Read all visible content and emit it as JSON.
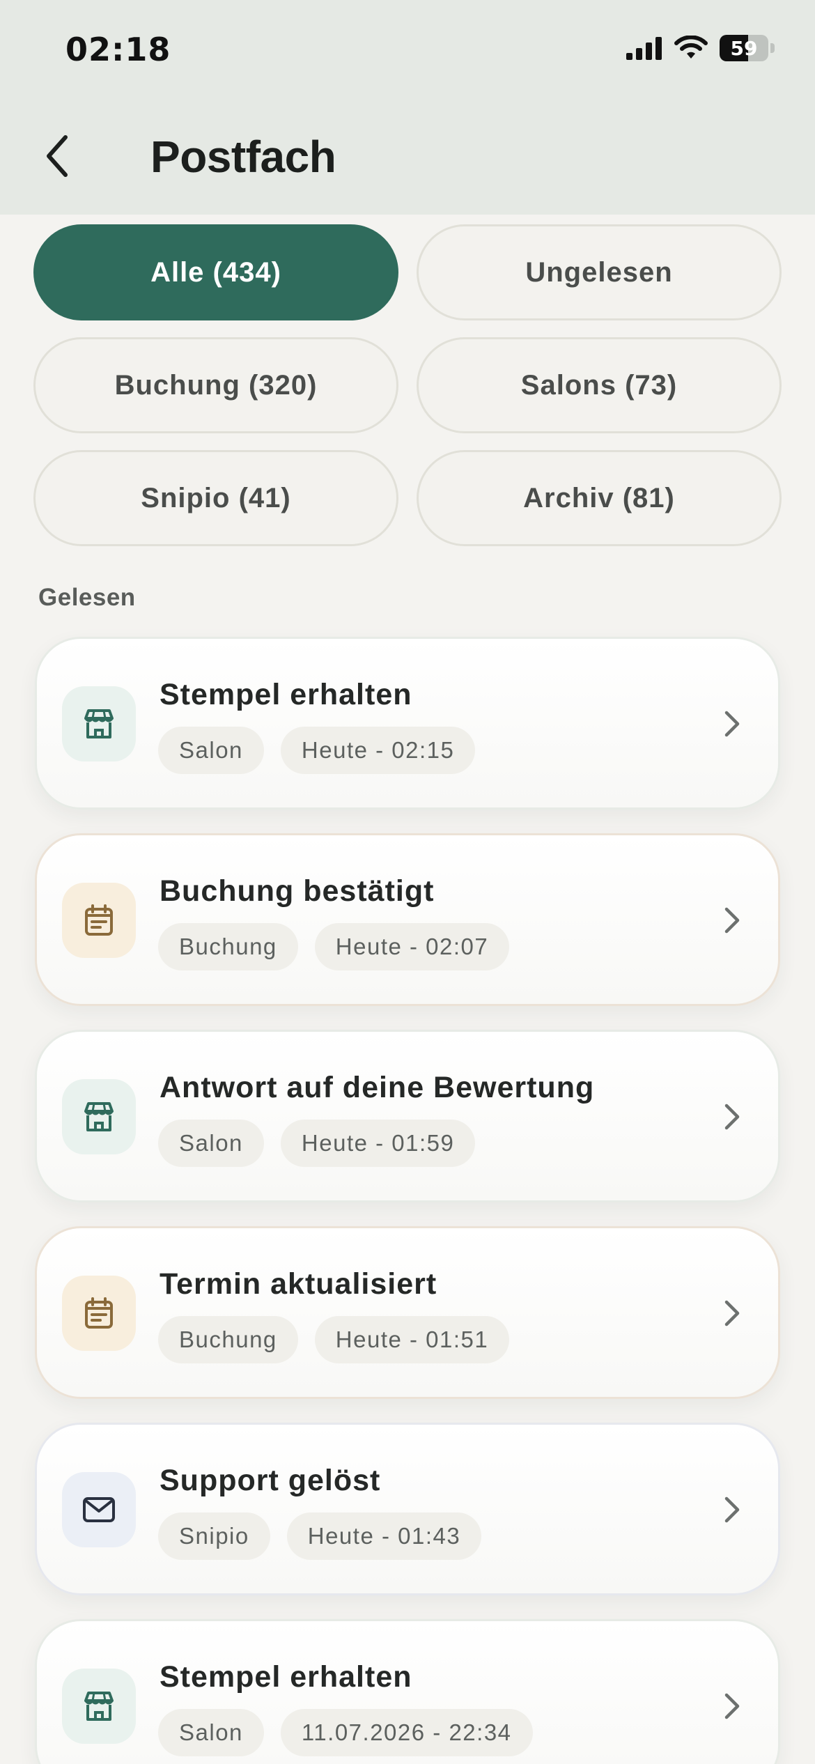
{
  "status_bar": {
    "time": "02:18",
    "battery_percent": 59,
    "battery_label": "59"
  },
  "header": {
    "title": "Postfach"
  },
  "filters": [
    {
      "label": "Alle (434)",
      "active": true
    },
    {
      "label": "Ungelesen",
      "active": false
    },
    {
      "label": "Buchung (320)",
      "active": false
    },
    {
      "label": "Salons (73)",
      "active": false
    },
    {
      "label": "Snipio (41)",
      "active": false
    },
    {
      "label": "Archiv (81)",
      "active": false
    }
  ],
  "section": {
    "label": "Gelesen"
  },
  "notifications": [
    {
      "title": "Stempel erhalten",
      "category": "Salon",
      "time": "Heute - 02:15",
      "icon": "store-icon"
    },
    {
      "title": "Buchung bestätigt",
      "category": "Buchung",
      "time": "Heute - 02:07",
      "icon": "calendar-icon"
    },
    {
      "title": "Antwort auf deine Bewertung",
      "category": "Salon",
      "time": "Heute - 01:59",
      "icon": "store-icon"
    },
    {
      "title": "Termin aktualisiert",
      "category": "Buchung",
      "time": "Heute - 01:51",
      "icon": "calendar-icon"
    },
    {
      "title": "Support gelöst",
      "category": "Snipio",
      "time": "Heute - 01:43",
      "icon": "mail-icon"
    },
    {
      "title": "Stempel erhalten",
      "category": "Salon",
      "time": "11.07.2026 - 22:34",
      "icon": "store-icon"
    }
  ],
  "colors": {
    "accent": "#2f6b5c",
    "header_bg": "#e5e9e4",
    "page_bg": "#f4f3f0",
    "salon_icon": "#2f6b5c",
    "booking_icon": "#8a6a3a",
    "snipio_icon": "#2a3140"
  }
}
